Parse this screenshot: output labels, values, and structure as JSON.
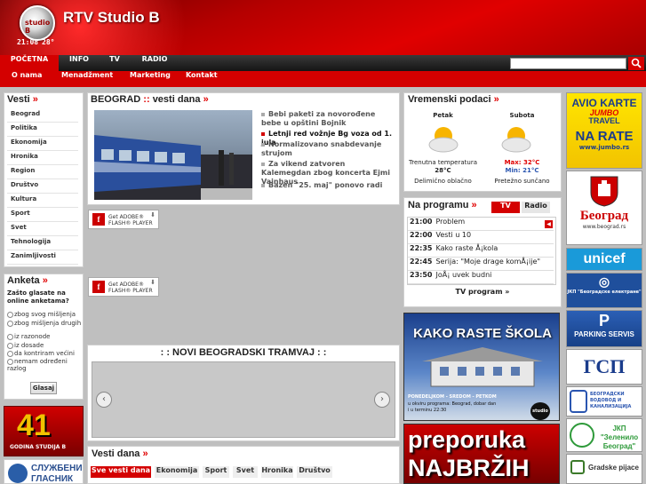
{
  "header": {
    "logo_badge": "studio B",
    "logo_text": "RTV Studio B",
    "clock": "21:08",
    "temperature": "28°"
  },
  "topnav": {
    "items": [
      {
        "label": "POČETNA"
      },
      {
        "label": "INFO"
      },
      {
        "label": "TV"
      },
      {
        "label": "RADIO"
      }
    ],
    "search_icon": "magnifier-icon"
  },
  "subnav": {
    "items": [
      {
        "label": "O nama"
      },
      {
        "label": "Menadžment"
      },
      {
        "label": "Marketing"
      },
      {
        "label": "Kontakt"
      }
    ]
  },
  "vesti_sidebar": {
    "title": "Vesti",
    "arrow": "»",
    "items": [
      "Beograd",
      "Politika",
      "Ekonomija",
      "Hronika",
      "Region",
      "Društvo",
      "Kultura",
      "Sport",
      "Svet",
      "Tehnologija",
      "Zanimljivosti"
    ]
  },
  "anketa": {
    "title": "Anketa",
    "arrow": "»",
    "question": "Zašto glasate na online anketama?",
    "options": [
      "zbog svog mišljenja",
      "zbog mišljenja drugih",
      "iz razonode",
      "iz dosade",
      "da kontriram većini",
      "nemam određeni razlog"
    ],
    "vote_label": "Glasaj"
  },
  "beograd_news": {
    "title_a": "BEOGRAD",
    "title_sep": "::",
    "title_b": "vesti dana",
    "arrow": "»",
    "items": [
      {
        "text": "Bebi paketi za novorođene bebe u opštini Bojnik",
        "active": false
      },
      {
        "text": "Letnji red vožnje Bg voza od 1. jula",
        "active": true
      },
      {
        "text": "Normalizovano snabdevanje strujom",
        "active": false
      },
      {
        "text": "Za vikend zatvoren Kalemegdan zbog koncerta Ejmi Vajnhaus",
        "active": false
      },
      {
        "text": "Bazen \"25. maj\" ponovo radi",
        "active": false
      }
    ]
  },
  "flash": {
    "line1": "Get ADOBE®",
    "line2": "FLASH® PLAYER"
  },
  "tramvaj": {
    "title": ": : NOVI BEOGRADSKI TRAMVAJ : :"
  },
  "vesti_dana": {
    "title": "Vesti dana",
    "arrow": "»",
    "tabs": [
      "Sve vesti dana",
      "Ekonomija",
      "Sport",
      "Svet",
      "Hronika",
      "Društvo"
    ]
  },
  "weather": {
    "title": "Vremenski podaci",
    "arrow": "»",
    "days": [
      {
        "name": "Petak",
        "line1_label": "Trenutna temperatura",
        "line1_value": "28°C",
        "line2": "Delimično oblačno",
        "icon": "sun-cloud-icon"
      },
      {
        "name": "Subota",
        "max": "Max: 32°C",
        "min": "Min: 21°C",
        "line2": "Pretežno sunčano",
        "icon": "sun-cloud-icon"
      }
    ]
  },
  "program": {
    "title": "Na programu",
    "arrow": "»",
    "tabs": [
      "TV",
      "Radio"
    ],
    "rows": [
      {
        "time": "21:00",
        "show": "Problem"
      },
      {
        "time": "22:00",
        "show": "Vesti u 10"
      },
      {
        "time": "22:35",
        "show": "Kako raste Å¡kola"
      },
      {
        "time": "22:45",
        "show": "Serija: \"Moje drage komÅ¡ije\""
      },
      {
        "time": "23:50",
        "show": "JoÅ¡ uvek budni"
      }
    ],
    "link": "TV program »"
  },
  "promo1": {
    "title": "KAKO RASTE ŠKOLA",
    "line1": "PONEDELJKOM - SREDOM - PETKOM",
    "line2": "u okviru programa: Beograd, dobar dan",
    "line3": "Beograd, dobar dan",
    "line4": "i u terminu 22:30",
    "badge": "studio B"
  },
  "promo2": {
    "line1": "preporuka",
    "line2": "NAJBRŽIH"
  },
  "ad41": {
    "number": "41",
    "caption": "GODINA STUDIJA B"
  },
  "glasnik": {
    "text": "СЛУЖБЕНИ ГЛАСНИК"
  },
  "ads": {
    "avio": {
      "l1": "AVIO KARTE",
      "l2": "JUMBO",
      "l3": "TRAVEL",
      "l4": "NA RATE",
      "l5": "www.jumbo.rs"
    },
    "beograd": {
      "label": "Београд",
      "url": "www.beograd.rs"
    },
    "unicef": "unicef",
    "eps": "ЈКП \"Београдске електране\"",
    "parking": "PARKING SERVIS",
    "gsp": "ГСП",
    "vodovod": "БЕОГРАДСКИ ВОДОВОД И КАНАЛИЗАЦИЈА",
    "zelenilo": "ЈКП \"Зеленило Београд\"",
    "pijace": "Gradske pijace"
  },
  "colors": {
    "brand_red": "#d40000",
    "nav_dark": "#1e1e1e"
  }
}
